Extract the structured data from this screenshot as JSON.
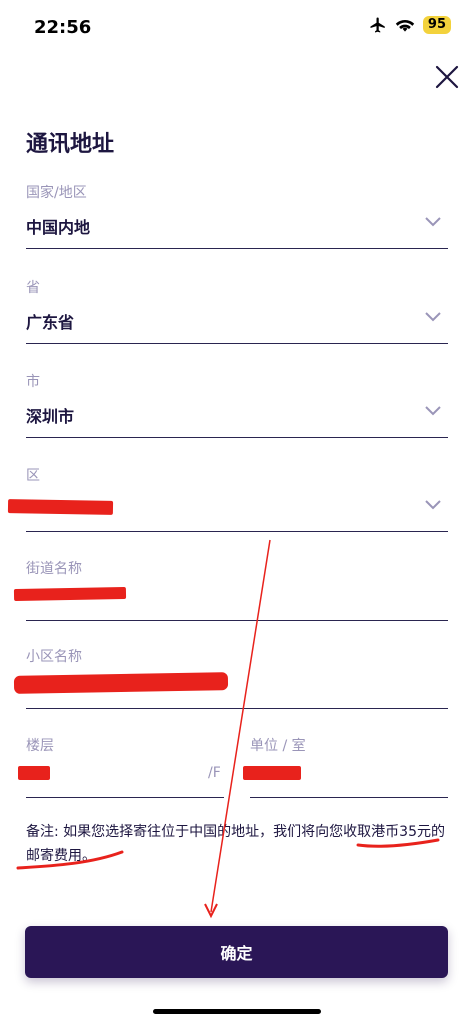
{
  "status": {
    "time": "22:56",
    "battery": "95"
  },
  "page": {
    "title": "通讯地址"
  },
  "fields": {
    "country": {
      "label": "国家/地区",
      "value": "中国内地"
    },
    "province": {
      "label": "省",
      "value": "广东省"
    },
    "city": {
      "label": "市",
      "value": "深圳市"
    },
    "district": {
      "label": "区"
    },
    "street": {
      "label": "街道名称"
    },
    "estate": {
      "label": "小区名称"
    },
    "floor": {
      "label": "楼层",
      "suffix": "/F"
    },
    "unit": {
      "label": "单位 / 室"
    }
  },
  "note": {
    "text": "备注: 如果您选择寄往位于中国的地址，我们将向您收取港币35元的邮寄费用。"
  },
  "confirm": {
    "label": "确定"
  },
  "colors": {
    "accent": "#2a1656",
    "label": "#9a95b8",
    "annotation": "#e8221c"
  },
  "icons": [
    "airplane-icon",
    "wifi-icon",
    "close-icon",
    "chevron-down-icon"
  ]
}
